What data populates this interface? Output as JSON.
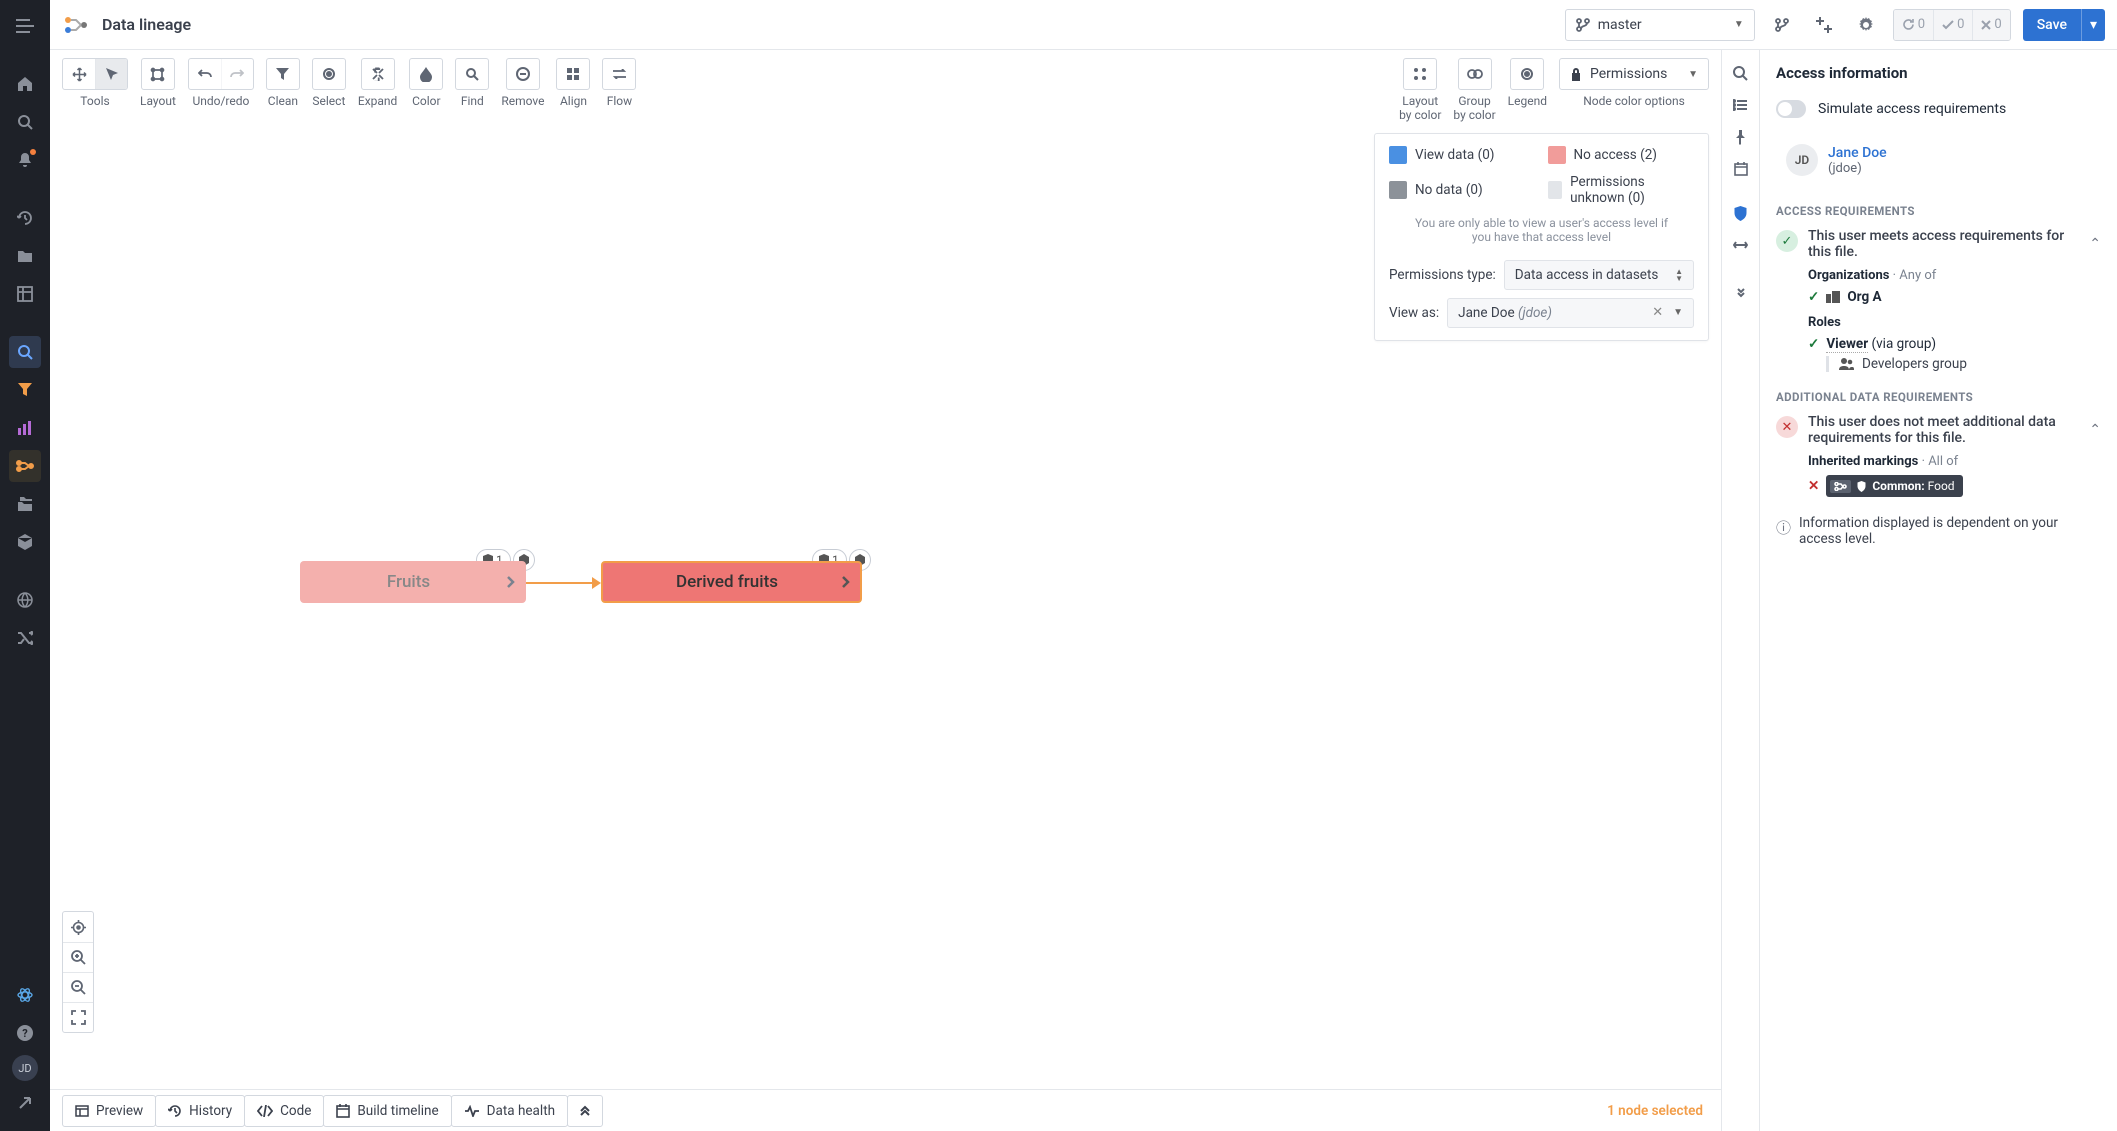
{
  "header": {
    "title": "Data lineage",
    "branch": "master",
    "status_pills": {
      "refresh": "0",
      "check": "0",
      "fail": "0"
    },
    "save": "Save"
  },
  "rail": {
    "avatar": "JD"
  },
  "toolbar": {
    "tools": "Tools",
    "layout": "Layout",
    "undoredo": "Undo/redo",
    "clean": "Clean",
    "select": "Select",
    "expand": "Expand",
    "color": "Color",
    "find": "Find",
    "remove": "Remove",
    "align": "Align",
    "flow": "Flow",
    "layout_by_color": "Layout\nby color",
    "group_by_color": "Group\nby color",
    "legend": "Legend",
    "permissions": "Permissions",
    "node_color": "Node color options"
  },
  "legend": {
    "items": [
      {
        "label": "View data (0)",
        "color": "#4a90e2"
      },
      {
        "label": "No access (2)",
        "color": "#f19c9a"
      },
      {
        "label": "No data (0)",
        "color": "#8c9299"
      },
      {
        "label": "Permissions unknown (0)",
        "color": "#e2e5e9"
      }
    ],
    "note": "You are only able to view a user's access level if you have that access level",
    "perm_type_label": "Permissions type:",
    "perm_type_value": "Data access in datasets",
    "view_as_label": "View as:",
    "view_as_name": "Jane Doe",
    "view_as_handle": "(jdoe)"
  },
  "nodes": {
    "fruits": {
      "label": "Fruits",
      "badge": "1"
    },
    "derived": {
      "label": "Derived fruits",
      "badge": "1"
    }
  },
  "bottom": {
    "preview": "Preview",
    "history": "History",
    "code": "Code",
    "build": "Build timeline",
    "health": "Data health",
    "selected": "1 node selected"
  },
  "panel": {
    "title": "Access information",
    "sim_label": "Simulate access requirements",
    "user": {
      "initials": "JD",
      "name": "Jane Doe",
      "handle": "(jdoe)"
    },
    "sec_access": "ACCESS REQUIREMENTS",
    "ok_msg": "This user meets access requirements for this file.",
    "orgs_label": "Organizations",
    "any_of": "Any of",
    "org_a": "Org A",
    "roles_label": "Roles",
    "viewer": "Viewer",
    "via_group": "(via group)",
    "dev_group": "Developers group",
    "sec_add": "ADDITIONAL DATA REQUIREMENTS",
    "bad_msg": "This user does not meet additional data requirements for this file.",
    "inherited_label": "Inherited markings",
    "all_of": "All of",
    "tag_prefix": "Common:",
    "tag_value": "Food",
    "info": "Information displayed is dependent on your access level."
  }
}
